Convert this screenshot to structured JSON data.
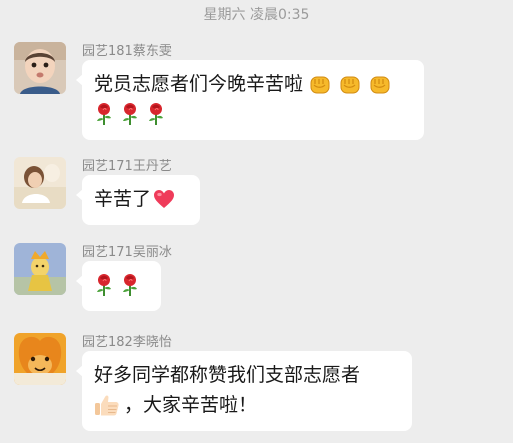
{
  "header": {
    "timestamp": "星期六 凌晨0:35"
  },
  "messages": [
    {
      "sender": "园艺181蔡东雯",
      "text": "党员志愿者们今晚辛苦啦",
      "emojis_line1": [
        "fist-icon",
        "fist-icon",
        "fist-icon"
      ],
      "emojis_line2": [
        "rose-icon",
        "rose-icon",
        "rose-icon"
      ]
    },
    {
      "sender": "园艺171王丹艺",
      "text": "辛苦了",
      "emojis_line1": [
        "heart-icon"
      ]
    },
    {
      "sender": "园艺171吴丽冰",
      "text": "",
      "emojis_line1": [
        "rose-icon",
        "rose-icon"
      ]
    },
    {
      "sender": "园艺182李晓怡",
      "text_line1": "好多同学都称赞我们支部志愿者",
      "text_line2": "，大家辛苦啦！",
      "emojis_line2": [
        "thumbs-up-icon"
      ]
    }
  ],
  "colors": {
    "background": "#ededed",
    "bubble": "#ffffff",
    "sender_name": "#8a8a8a",
    "timestamp": "#9b9b9b"
  }
}
